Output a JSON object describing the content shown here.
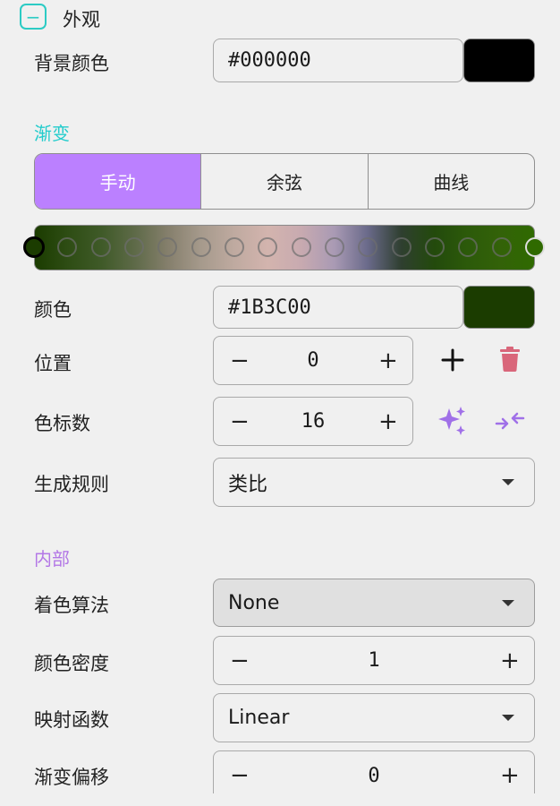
{
  "appearance": {
    "title": "外观",
    "collapse_glyph": "−",
    "bg_color_label": "背景颜色",
    "bg_color_value": "#000000",
    "bg_swatch_color": "#000000"
  },
  "gradient": {
    "title": "渐变",
    "title_color": "#22cccc",
    "tabs": [
      "手动",
      "余弦",
      "曲线"
    ],
    "active_tab": 0,
    "stops": [
      "#1B3C00",
      "#2e4d14",
      "#3f5a28",
      "#5e6a48",
      "#857f6c",
      "#a69a8c",
      "#bfaaa0",
      "#d3b4ae",
      "#c8aab0",
      "#a99ab4",
      "#6a6a8a",
      "#2f3f30",
      "#234a0c",
      "#2c5a0a",
      "#336208",
      "#2f6a00"
    ],
    "selected_stop": 0,
    "color_label": "颜色",
    "color_value": "#1B3C00",
    "color_swatch": "#1B3C00",
    "position_label": "位置",
    "position_value": "0",
    "stops_label": "色标数",
    "stops_value": "16",
    "rule_label": "生成规则",
    "rule_value": "类比",
    "minus": "−",
    "plus": "+"
  },
  "interior": {
    "title": "内部",
    "title_color": "#b377e6",
    "coloring_label": "着色算法",
    "coloring_value": "None",
    "density_label": "颜色密度",
    "density_value": "1",
    "mapping_label": "映射函数",
    "mapping_value": "Linear",
    "offset_label": "渐变偏移",
    "offset_value": "0"
  },
  "colors": {
    "accent_purple": "#bb80ff",
    "delete_red": "#d9667a",
    "sparkle_purple": "#a070e8"
  }
}
